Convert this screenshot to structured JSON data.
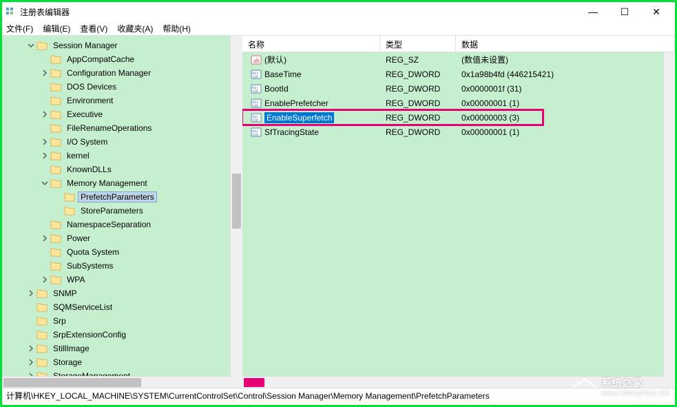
{
  "window": {
    "title": "注册表编辑器",
    "min": "—",
    "max": "☐",
    "close": "✕"
  },
  "menu": {
    "file": "文件(F)",
    "edit": "编辑(E)",
    "view": "查看(V)",
    "favorites": "收藏夹(A)",
    "help": "帮助(H)"
  },
  "tree": [
    {
      "indent": 0,
      "exp": "open",
      "label": "Session Manager"
    },
    {
      "indent": 1,
      "exp": "none",
      "label": "AppCompatCache"
    },
    {
      "indent": 1,
      "exp": "close",
      "label": "Configuration Manager"
    },
    {
      "indent": 1,
      "exp": "none",
      "label": "DOS Devices"
    },
    {
      "indent": 1,
      "exp": "none",
      "label": "Environment"
    },
    {
      "indent": 1,
      "exp": "close",
      "label": "Executive"
    },
    {
      "indent": 1,
      "exp": "none",
      "label": "FileRenameOperations"
    },
    {
      "indent": 1,
      "exp": "close",
      "label": "I/O System"
    },
    {
      "indent": 1,
      "exp": "close",
      "label": "kernel"
    },
    {
      "indent": 1,
      "exp": "none",
      "label": "KnownDLLs"
    },
    {
      "indent": 1,
      "exp": "open",
      "label": "Memory Management"
    },
    {
      "indent": 2,
      "exp": "none",
      "label": "PrefetchParameters",
      "selected": true
    },
    {
      "indent": 2,
      "exp": "none",
      "label": "StoreParameters"
    },
    {
      "indent": 1,
      "exp": "none",
      "label": "NamespaceSeparation"
    },
    {
      "indent": 1,
      "exp": "close",
      "label": "Power"
    },
    {
      "indent": 1,
      "exp": "none",
      "label": "Quota System"
    },
    {
      "indent": 1,
      "exp": "none",
      "label": "SubSystems"
    },
    {
      "indent": 1,
      "exp": "close",
      "label": "WPA"
    },
    {
      "indent": 0,
      "exp": "close",
      "label": "SNMP"
    },
    {
      "indent": 0,
      "exp": "none",
      "label": "SQMServiceList"
    },
    {
      "indent": 0,
      "exp": "none",
      "label": "Srp"
    },
    {
      "indent": 0,
      "exp": "none",
      "label": "SrpExtensionConfig"
    },
    {
      "indent": 0,
      "exp": "close",
      "label": "StillImage"
    },
    {
      "indent": 0,
      "exp": "close",
      "label": "Storage"
    },
    {
      "indent": 0,
      "exp": "close",
      "label": "StorageManagement"
    }
  ],
  "list": {
    "header": {
      "name": "名称",
      "type": "类型",
      "data": "数据"
    },
    "rows": [
      {
        "icon": "str",
        "name": "(默认)",
        "type": "REG_SZ",
        "data": "(数值未设置)"
      },
      {
        "icon": "bin",
        "name": "BaseTime",
        "type": "REG_DWORD",
        "data": "0x1a98b4fd (446215421)"
      },
      {
        "icon": "bin",
        "name": "BootId",
        "type": "REG_DWORD",
        "data": "0x0000001f (31)"
      },
      {
        "icon": "bin",
        "name": "EnablePrefetcher",
        "type": "REG_DWORD",
        "data": "0x00000001 (1)"
      },
      {
        "icon": "bin",
        "name": "EnableSuperfetch",
        "type": "REG_DWORD",
        "data": "0x00000003 (3)",
        "selected": true
      },
      {
        "icon": "bin",
        "name": "SfTracingState",
        "type": "REG_DWORD",
        "data": "0x00000001 (1)"
      }
    ]
  },
  "status": {
    "path": "计算机\\HKEY_LOCAL_MACHINE\\SYSTEM\\CurrentControlSet\\Control\\Session Manager\\Memory Management\\PrefetchParameters"
  },
  "watermark": {
    "title": "系统之家",
    "url": "www.xitongzhijia.net"
  }
}
